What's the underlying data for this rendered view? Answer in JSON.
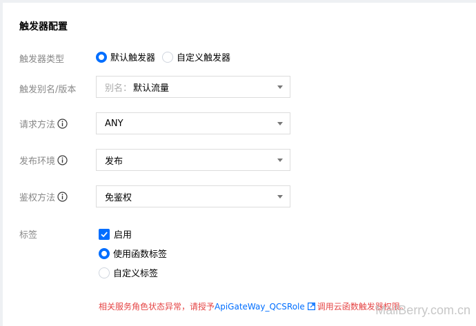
{
  "section": {
    "title": "触发器配置"
  },
  "trigger_type": {
    "label": "触发器类型",
    "options": [
      {
        "label": "默认触发器",
        "selected": true
      },
      {
        "label": "自定义触发器",
        "selected": false
      }
    ]
  },
  "alias": {
    "label": "触发别名/版本",
    "prefix": "别名：",
    "value": "默认流量"
  },
  "request_method": {
    "label": "请求方法",
    "value": "ANY"
  },
  "publish_env": {
    "label": "发布环境",
    "value": "发布"
  },
  "auth_method": {
    "label": "鉴权方法",
    "value": "免鉴权"
  },
  "tags": {
    "label": "标签",
    "enable_label": "启用",
    "enabled": true,
    "options": [
      {
        "label": "使用函数标签",
        "selected": true
      },
      {
        "label": "自定义标签",
        "selected": false
      }
    ]
  },
  "error": {
    "text_before": "相关服务角色状态异常，请授予",
    "link": "ApiGateWay_QCSRole",
    "text_after": "调用云函数触发器权限。"
  },
  "watermark": "MailBerry.com.cn",
  "colors": {
    "accent": "#006eff",
    "error": "#e54545",
    "label": "#888888"
  }
}
